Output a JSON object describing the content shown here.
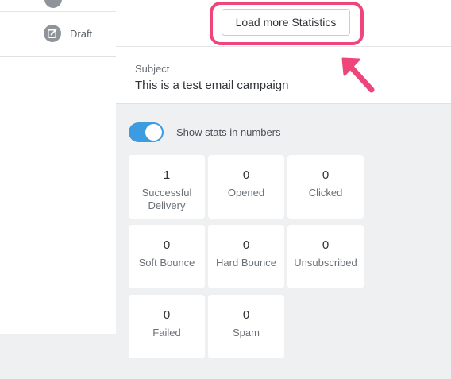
{
  "list": {
    "status_label": "Draft",
    "status_icon": "edit-icon"
  },
  "detail": {
    "load_more_label": "Load more Statistics",
    "highlight_color": "#f0457a",
    "subject_label": "Subject",
    "subject_value": "This is a test email campaign",
    "toggle": {
      "label": "Show stats in numbers",
      "on": true,
      "color": "#3d9be0"
    },
    "stats": [
      {
        "value": "1",
        "label": "Successful Delivery"
      },
      {
        "value": "0",
        "label": "Opened"
      },
      {
        "value": "0",
        "label": "Clicked"
      },
      {
        "value": "0",
        "label": "Soft Bounce"
      },
      {
        "value": "0",
        "label": "Hard Bounce"
      },
      {
        "value": "0",
        "label": "Unsubscribed"
      },
      {
        "value": "0",
        "label": "Failed"
      },
      {
        "value": "0",
        "label": "Spam"
      }
    ]
  }
}
